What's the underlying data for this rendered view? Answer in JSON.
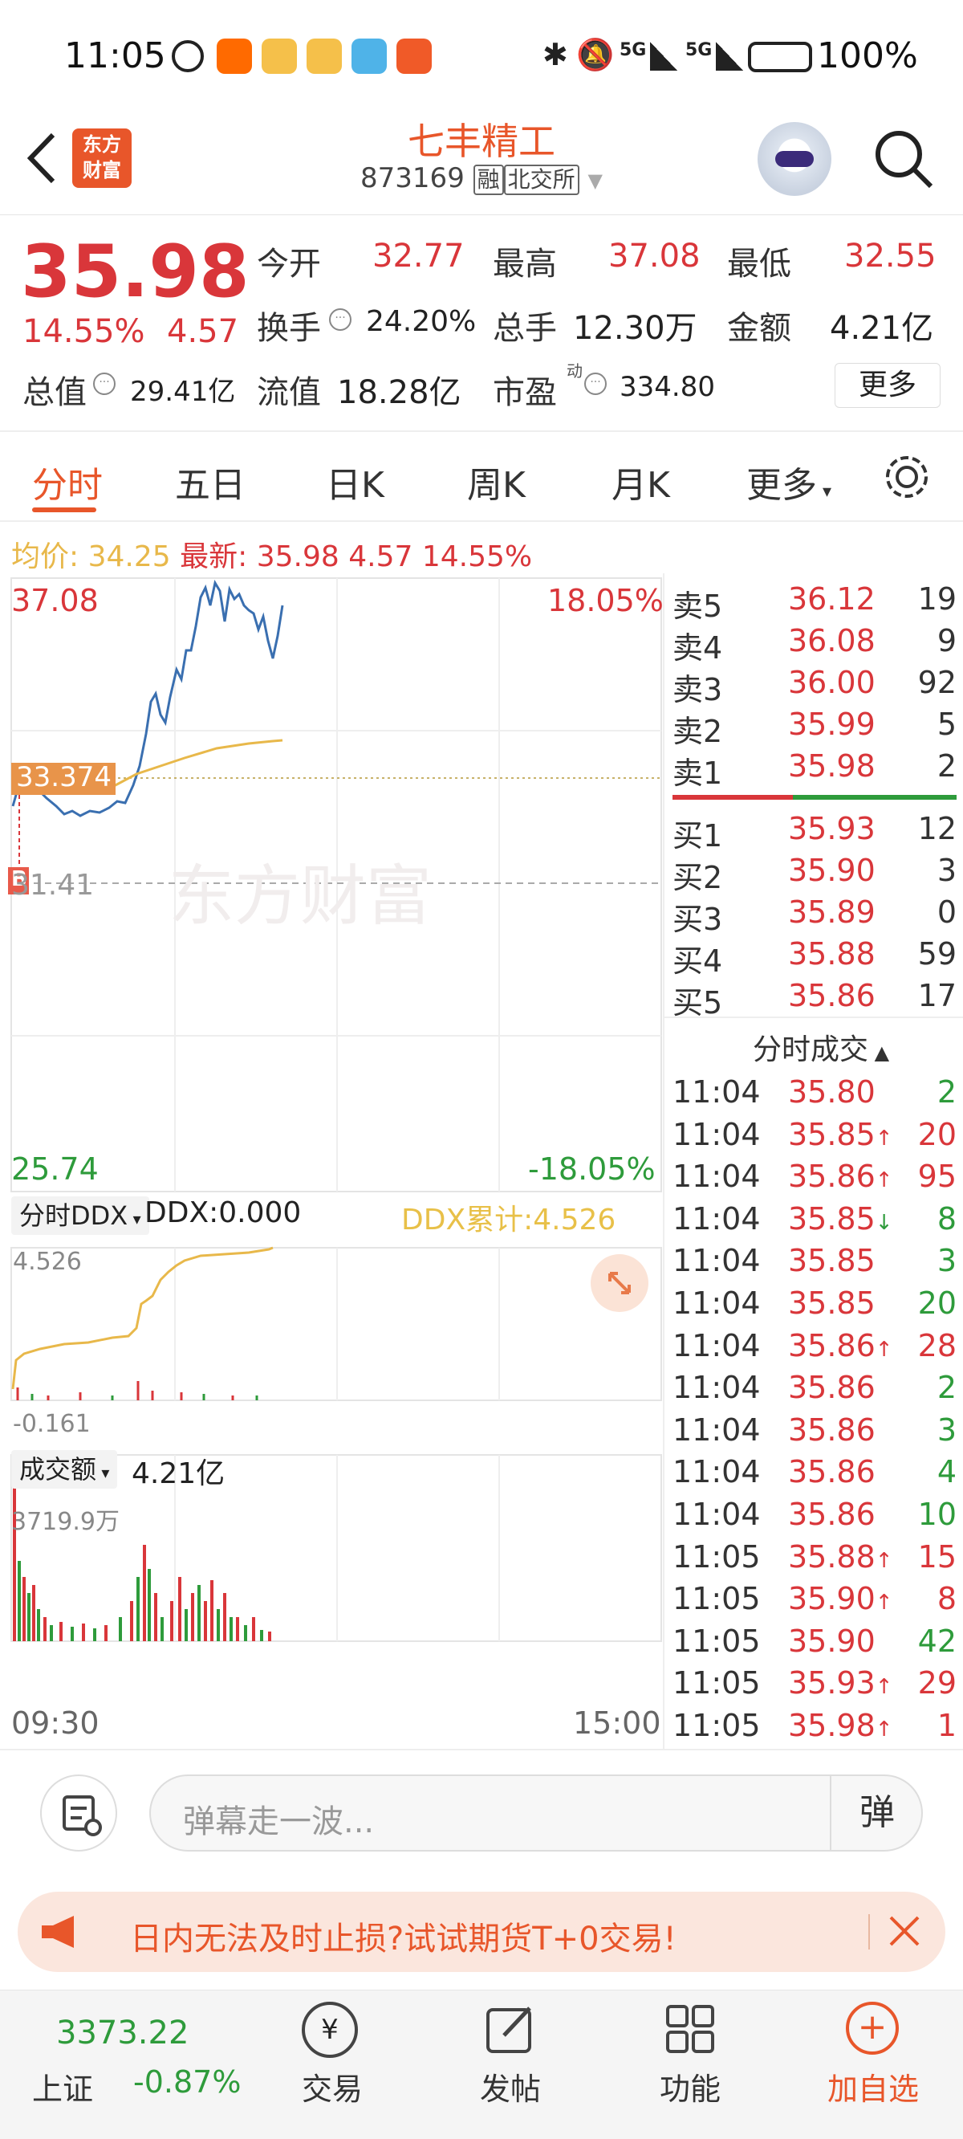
{
  "status_bar": {
    "time": "11:05",
    "battery": "100%",
    "signal1": "5G",
    "signal2": "5G"
  },
  "header": {
    "title": "七丰精工",
    "code": "873169",
    "tag_margin": "融",
    "tag_exchange": "北交所",
    "logo_line1": "东方",
    "logo_line2": "财富"
  },
  "quote": {
    "price": "35.98",
    "change_pct": "14.55%",
    "change": "4.57",
    "open_label": "今开",
    "open": "32.77",
    "high_label": "最高",
    "high": "37.08",
    "low_label": "最低",
    "low": "32.55",
    "turnover_label": "换手",
    "turnover": "24.20%",
    "volume_label": "总手",
    "volume": "12.30万",
    "amount_label": "金额",
    "amount": "4.21亿",
    "mktcap_label": "总值",
    "mktcap": "29.41亿",
    "float_label": "流值",
    "float": "18.28亿",
    "pe_label": "市盈",
    "pe_sup": "动",
    "pe": "334.80",
    "more": "更多"
  },
  "tabs": [
    "分时",
    "五日",
    "日K",
    "周K",
    "月K",
    "更多"
  ],
  "avg_line": {
    "avg_label": "均价:",
    "avg": "34.25",
    "last_label": "最新:",
    "last": "35.98",
    "chg": "4.57",
    "pct": "14.55%"
  },
  "chart": {
    "top_price": "37.08",
    "top_pct": "18.05%",
    "bottom_price": "25.74",
    "bottom_pct": "-18.05%",
    "cursor_price": "33.374",
    "prev_close": "31.41",
    "watermark": "东方财富",
    "marker": "B",
    "time_start": "09:30",
    "time_end": "15:00"
  },
  "ddx": {
    "selector": "分时DDX",
    "value_text": "DDX:0.000",
    "cum_text": "DDX累计:4.526",
    "top": "4.526",
    "bottom": "-0.161"
  },
  "volume": {
    "selector": "成交额",
    "value": "4.21亿",
    "top": "3719.9万"
  },
  "orderbook": {
    "asks": [
      {
        "label": "卖5",
        "price": "36.12",
        "qty": "19"
      },
      {
        "label": "卖4",
        "price": "36.08",
        "qty": "9"
      },
      {
        "label": "卖3",
        "price": "36.00",
        "qty": "92"
      },
      {
        "label": "卖2",
        "price": "35.99",
        "qty": "5"
      },
      {
        "label": "卖1",
        "price": "35.98",
        "qty": "2"
      }
    ],
    "bids": [
      {
        "label": "买1",
        "price": "35.93",
        "qty": "12"
      },
      {
        "label": "买2",
        "price": "35.90",
        "qty": "3"
      },
      {
        "label": "买3",
        "price": "35.89",
        "qty": "0"
      },
      {
        "label": "买4",
        "price": "35.88",
        "qty": "59"
      },
      {
        "label": "买5",
        "price": "35.86",
        "qty": "17"
      }
    ]
  },
  "trades_title": "分时成交",
  "trades": [
    {
      "time": "11:04",
      "price": "35.80",
      "dir": "",
      "qty": "2",
      "qcolor": "green"
    },
    {
      "time": "11:04",
      "price": "35.85",
      "dir": "up",
      "qty": "20",
      "qcolor": "red"
    },
    {
      "time": "11:04",
      "price": "35.86",
      "dir": "up",
      "qty": "95",
      "qcolor": "red"
    },
    {
      "time": "11:04",
      "price": "35.85",
      "dir": "down",
      "qty": "8",
      "qcolor": "green"
    },
    {
      "time": "11:04",
      "price": "35.85",
      "dir": "",
      "qty": "3",
      "qcolor": "green"
    },
    {
      "time": "11:04",
      "price": "35.85",
      "dir": "",
      "qty": "20",
      "qcolor": "green"
    },
    {
      "time": "11:04",
      "price": "35.86",
      "dir": "up",
      "qty": "28",
      "qcolor": "red"
    },
    {
      "time": "11:04",
      "price": "35.86",
      "dir": "",
      "qty": "2",
      "qcolor": "green"
    },
    {
      "time": "11:04",
      "price": "35.86",
      "dir": "",
      "qty": "3",
      "qcolor": "green"
    },
    {
      "time": "11:04",
      "price": "35.86",
      "dir": "",
      "qty": "4",
      "qcolor": "green"
    },
    {
      "time": "11:04",
      "price": "35.86",
      "dir": "",
      "qty": "10",
      "qcolor": "green"
    },
    {
      "time": "11:05",
      "price": "35.88",
      "dir": "up",
      "qty": "15",
      "qcolor": "red"
    },
    {
      "time": "11:05",
      "price": "35.90",
      "dir": "up",
      "qty": "8",
      "qcolor": "red"
    },
    {
      "time": "11:05",
      "price": "35.90",
      "dir": "",
      "qty": "42",
      "qcolor": "green"
    },
    {
      "time": "11:05",
      "price": "35.93",
      "dir": "up",
      "qty": "29",
      "qcolor": "red"
    },
    {
      "time": "11:05",
      "price": "35.98",
      "dir": "up",
      "qty": "1",
      "qcolor": "red"
    }
  ],
  "danmu": {
    "placeholder": "弹幕走一波...",
    "btn": "弹"
  },
  "ad": {
    "text": "日内无法及时止损?试试期货T+0交易!"
  },
  "bottom_nav": {
    "index_value": "3373.22",
    "index_name": "上证",
    "index_pct": "-0.87%",
    "trade": "交易",
    "post": "发帖",
    "func": "功能",
    "watch": "加自选"
  },
  "colors": {
    "up": "#d9363a",
    "down": "#2e9b3b",
    "accent": "#e8562a",
    "price_line": "#3a6fb0",
    "avg_line": "#e8b84a"
  }
}
